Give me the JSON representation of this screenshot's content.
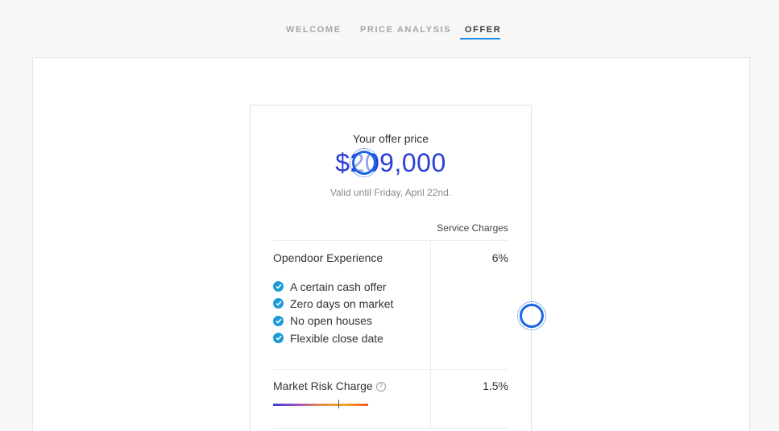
{
  "nav": {
    "tabs": [
      {
        "label": "WELCOME"
      },
      {
        "label": "PRICE ANALYSIS"
      },
      {
        "label": "OFFER"
      }
    ]
  },
  "offer": {
    "title": "Your offer price",
    "price": "$209,000",
    "valid": "Valid until Friday, April 22nd."
  },
  "charges": {
    "column_header": "Service Charges",
    "experience": {
      "label": "Opendoor Experience",
      "value": "6%",
      "features": [
        "A certain cash offer",
        "Zero days on market",
        "No open houses",
        "Flexible close date"
      ]
    },
    "market_risk": {
      "label": "Market Risk Charge",
      "value": "1.5%",
      "help_icon": "question-circle-icon",
      "risk_level": 0.69
    }
  },
  "colors": {
    "accent": "#1e88e5",
    "price": "#2c3ed8",
    "check": "#1d9bd7"
  }
}
